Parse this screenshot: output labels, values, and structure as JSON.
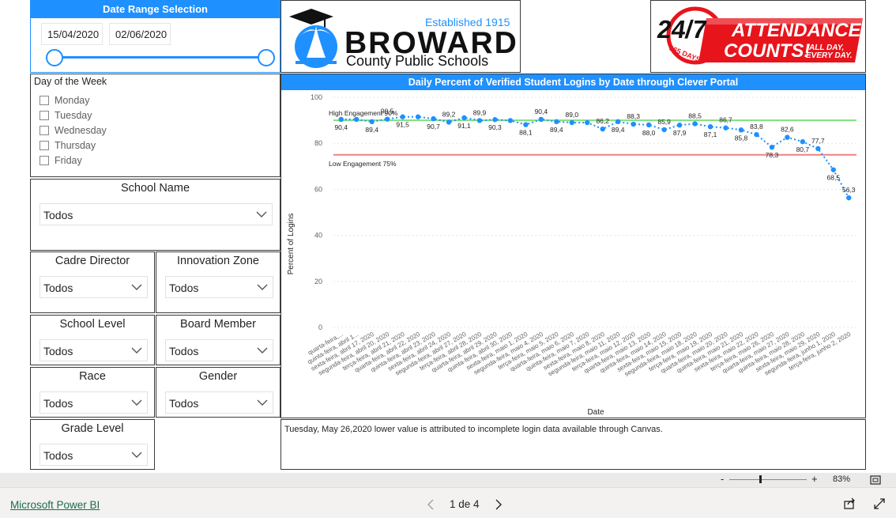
{
  "date_range": {
    "title": "Date Range Selection",
    "start": "15/04/2020",
    "end": "02/06/2020"
  },
  "logo_broward": {
    "established": "Established 1915",
    "name": "BROWARD",
    "subtitle": "County Public Schools"
  },
  "logo_attendance": {
    "big": "24/7",
    "days": "365 DAYS",
    "line1": "ATTENDANCE",
    "line2": "COUNTS!",
    "tag1": "ALL DAY,",
    "tag2": "EVERY DAY."
  },
  "day_of_week": {
    "title": "Day of the Week",
    "items": [
      "Monday",
      "Tuesday",
      "Wednesday",
      "Thursday",
      "Friday"
    ]
  },
  "slicers": {
    "school_name": {
      "title": "School Name",
      "value": "Todos"
    },
    "cadre_director": {
      "title": "Cadre Director",
      "value": "Todos"
    },
    "innovation_zone": {
      "title": "Innovation Zone",
      "value": "Todos"
    },
    "school_level": {
      "title": "School Level",
      "value": "Todos"
    },
    "board_member": {
      "title": "Board Member",
      "value": "Todos"
    },
    "race": {
      "title": "Race",
      "value": "Todos"
    },
    "gender": {
      "title": "Gender",
      "value": "Todos"
    },
    "grade_level": {
      "title": "Grade Level",
      "value": "Todos"
    }
  },
  "chart_data": {
    "type": "line",
    "title": "Daily Percent of Verified Student Logins by Date through Clever Portal",
    "xlabel": "Date",
    "ylabel": "Percent of Logins",
    "ylim": [
      0,
      100
    ],
    "yticks": [
      0,
      20,
      40,
      60,
      80,
      100
    ],
    "grid": true,
    "categories": [
      "quarta-feira,...",
      "quinta-feira, abril 1...",
      "sexta-feira, abril 17, 2020",
      "segunda-feira, abril 20, 2020",
      "terça-feira, abril 21, 2020",
      "quarta-feira, abril 22, 2020",
      "quinta-feira, abril 23, 2020",
      "sexta-feira, abril 24, 2020",
      "segunda-feira, abril 27, 2020",
      "terça-feira, abril 28, 2020",
      "quarta-feira, abril 29, 2020",
      "quinta-feira, abril 30, 2020",
      "sexta-feira, maio 1, 2020",
      "segunda-feira, maio 4, 2020",
      "terça-feira, maio 5, 2020",
      "quarta-feira, maio 6, 2020",
      "quinta-feira, maio 7, 2020",
      "sexta-feira, maio 8, 2020",
      "segunda-feira, maio 11, 2020",
      "terça-feira, maio 12, 2020",
      "quarta-feira, maio 13, 2020",
      "quinta-feira, maio 14, 2020",
      "sexta-feira, maio 15, 2020",
      "segunda-feira, maio 18, 2020",
      "terça-feira, maio 19, 2020",
      "quarta-feira, maio 20, 2020",
      "quinta-feira, maio 21, 2020",
      "sexta-feira, maio 22, 2020",
      "terça-feira, maio 26, 2020",
      "quarta-feira, maio 27, 2020",
      "quinta-feira, maio 28, 2020",
      "sexta-feira, maio 29, 2020",
      "segunda-feira, junho 1, 2020",
      "terça-feira, junho 2, 2020"
    ],
    "values": [
      90.4,
      90.4,
      89.4,
      90.5,
      91.5,
      91.5,
      90.7,
      89.2,
      91.1,
      89.9,
      90.3,
      89.9,
      88.1,
      90.4,
      89.4,
      89.0,
      89.0,
      86.2,
      89.4,
      88.3,
      88.0,
      85.9,
      87.9,
      88.5,
      87.2,
      86.7,
      85.8,
      83.8,
      78.3,
      82.6,
      80.7,
      77.7,
      68.5,
      56.3
    ],
    "point_labels": [
      "90,4",
      "",
      "89,4",
      "90,5",
      "91,5",
      "",
      "90,7",
      "89,2",
      "91,1",
      "89,9",
      "90,3",
      "",
      "88,1",
      "90,4",
      "89,4",
      "89,0",
      "",
      "86,2",
      "89,4",
      "88,3",
      "88,0",
      "85,9",
      "87,9",
      "88,5",
      "87,1",
      "86,7",
      "85,8",
      "83,8",
      "78,3",
      "82,6",
      "80,7",
      "77,7",
      "68,5",
      "56,3"
    ],
    "reference_lines": [
      {
        "name": "High Engagement 90%",
        "value": 90,
        "color": "#7ee07e"
      },
      {
        "name": "Low Engagement 75%",
        "value": 75,
        "color": "#f08080"
      }
    ],
    "series_color": "#1e90ff"
  },
  "note": {
    "text": "Tuesday, May 26,2020  lower value is attributed to incomplete login data available through Canvas."
  },
  "zoom": {
    "minus": "-",
    "plus": "+",
    "level": "83%"
  },
  "footer": {
    "brand": "Microsoft Power BI",
    "page": "1 de 4"
  }
}
